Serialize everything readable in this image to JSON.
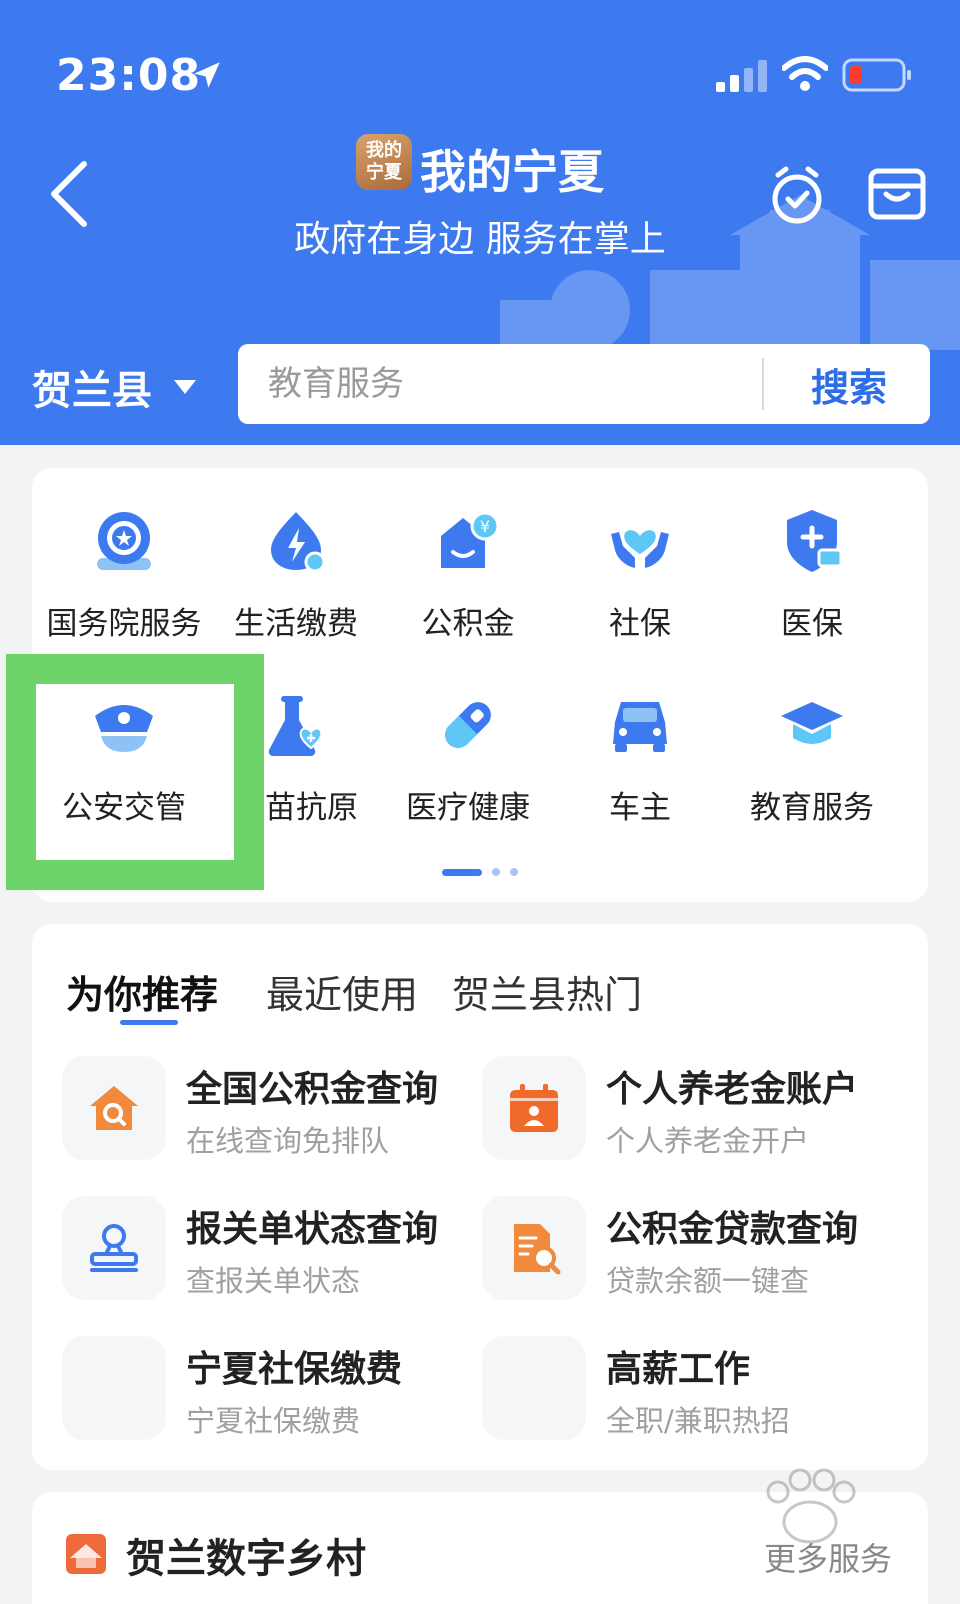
{
  "status_bar": {
    "time": "23:08"
  },
  "header": {
    "logo_text_top": "我的",
    "logo_text_bottom": "宁夏",
    "title": "我的宁夏",
    "slogan": "政府在身边 服务在掌上"
  },
  "region": {
    "label": "贺兰县"
  },
  "search": {
    "placeholder": "教育服务",
    "button_label": "搜索"
  },
  "services": [
    {
      "label": "国务院服务",
      "icon": "state-council-icon"
    },
    {
      "label": "生活缴费",
      "icon": "utility-payment-icon"
    },
    {
      "label": "公积金",
      "icon": "housing-fund-icon"
    },
    {
      "label": "社保",
      "icon": "social-security-icon"
    },
    {
      "label": "医保",
      "icon": "medical-insurance-icon"
    },
    {
      "label": "公安交管",
      "icon": "police-cap-icon"
    },
    {
      "label": "疫苗抗原",
      "icon": "vaccine-flask-icon"
    },
    {
      "label": "医疗健康",
      "icon": "pill-icon"
    },
    {
      "label": "车主",
      "icon": "car-icon"
    },
    {
      "label": "教育服务",
      "icon": "graduation-cap-icon"
    }
  ],
  "recommend": {
    "tabs": [
      "为你推荐",
      "最近使用",
      "贺兰县热门"
    ],
    "active_tab": 0,
    "items": [
      {
        "title": "全国公积金查询",
        "subtitle": "在线查询免排队",
        "icon": "house-search-icon"
      },
      {
        "title": "个人养老金账户",
        "subtitle": "个人养老金开户",
        "icon": "calendar-person-icon"
      },
      {
        "title": "报关单状态查询",
        "subtitle": "查报关单状态",
        "icon": "stamp-icon"
      },
      {
        "title": "公积金贷款查询",
        "subtitle": "贷款余额一键查",
        "icon": "document-search-icon"
      },
      {
        "title": "宁夏社保缴费",
        "subtitle": "宁夏社保缴费",
        "icon": ""
      },
      {
        "title": "高薪工作",
        "subtitle": "全职/兼职热招",
        "icon": ""
      }
    ]
  },
  "village": {
    "title": "贺兰数字乡村",
    "more_label": "更多服务"
  },
  "colors": {
    "primary": "#3d7af0",
    "highlight": "#6dd36a",
    "orange": "#f08a3c"
  }
}
